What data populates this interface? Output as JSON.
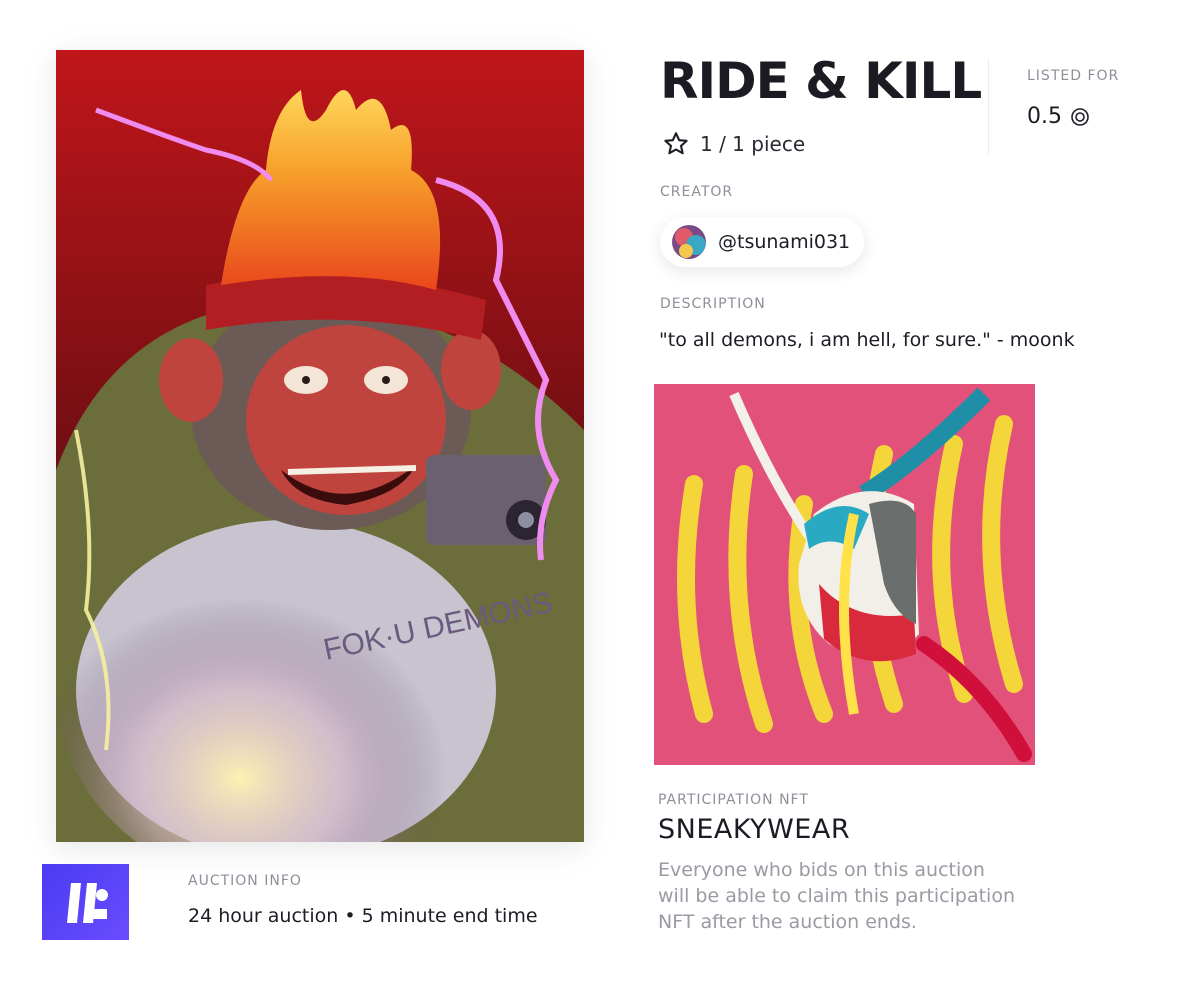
{
  "artwork": {
    "alt": "artwork"
  },
  "header": {
    "title": "RIDE & KILL",
    "edition": "1 / 1 piece",
    "listed_label": "LISTED FOR",
    "listed_price": "0.5"
  },
  "creator": {
    "label": "CREATOR",
    "handle": "@tsunami031"
  },
  "description": {
    "label": "DESCRIPTION",
    "text": "\"to all demons, i am hell, for sure.\" - moonk"
  },
  "participation": {
    "label": "PARTICIPATION NFT",
    "title": "SNEAKYWEAR",
    "text": "Everyone who bids on this auction will be able to claim this participation NFT after the auction ends."
  },
  "auction": {
    "label": "AUCTION INFO",
    "text": "24 hour auction • 5 minute end time"
  },
  "colors": {
    "accent": "#5b44f5",
    "muted": "#9a9aa3",
    "text": "#1c1c25"
  }
}
